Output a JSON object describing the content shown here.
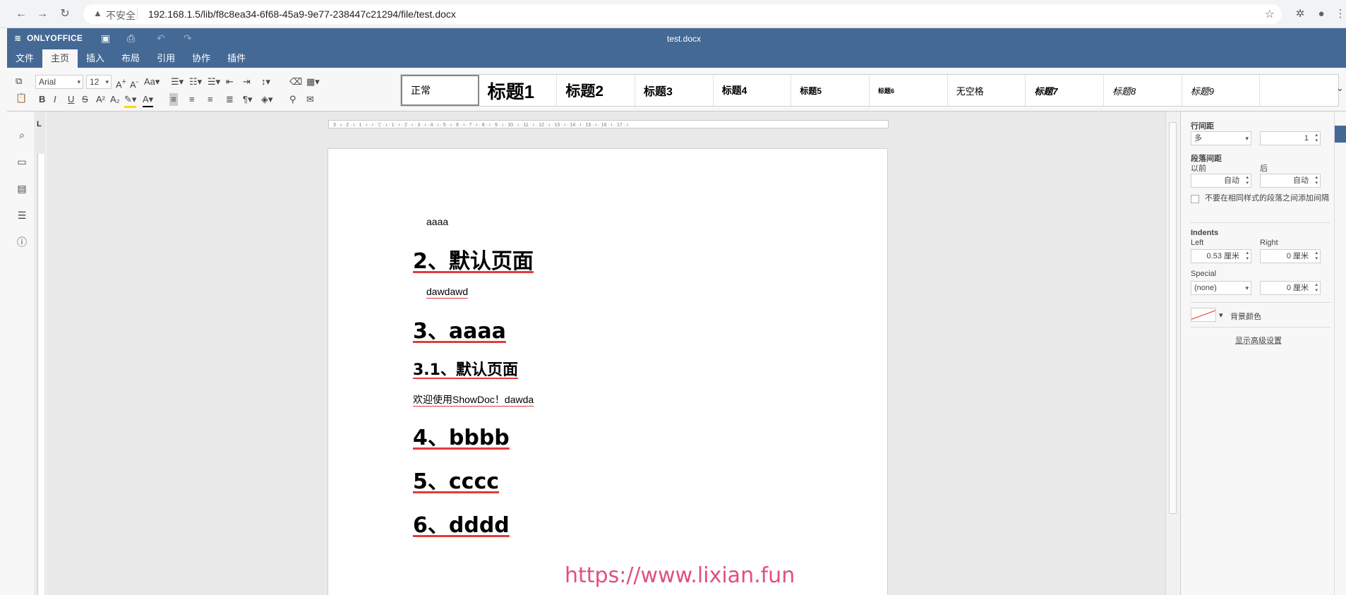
{
  "browser": {
    "insecure_label": "不安全",
    "url": "192.168.1.5/lib/f8c8ea34-6f68-45a9-9e77-238447c21294/file/test.docx"
  },
  "app": {
    "brand": "ONLYOFFICE",
    "doc_title": "test.docx",
    "accent": "#446995",
    "menu_tabs": [
      "文件",
      "主页",
      "插入",
      "布局",
      "引用",
      "协作",
      "插件"
    ],
    "active_tab": "主页"
  },
  "ribbon": {
    "font_name": "Arial",
    "font_size": "12",
    "styles": [
      "正常",
      "标题1",
      "标题2",
      "标题3",
      "标题4",
      "标题5",
      "标题6",
      "无空格",
      "标题7",
      "标题8",
      "标题9"
    ]
  },
  "document": {
    "lines": {
      "p1": "aaaa",
      "h2": "2、默认页面",
      "p2": "dawdawd",
      "h3": "3、aaaa",
      "h31": "3.1、默认页面",
      "p3": "欢迎使用ShowDoc！dawda",
      "h4": "4、bbbb",
      "h5": "5、cccc",
      "h6": "6、dddd"
    },
    "watermark": "https://www.lixian.fun"
  },
  "right_panel": {
    "line_spacing_label": "行间距",
    "line_spacing_mode": "多",
    "line_spacing_value": "1",
    "para_spacing_label": "段落间距",
    "before_label": "以前",
    "after_label": "后",
    "before_value": "自动",
    "after_value": "自动",
    "no_space_checkbox": "不要在相同样式的段落之间添加间隔",
    "indents_label": "Indents",
    "left_label": "Left",
    "right_label": "Right",
    "left_value": "0.53 厘米",
    "right_value": "0 厘米",
    "special_label": "Special",
    "special_value": "(none)",
    "special_amount": "0 厘米",
    "bg_color_label": "背景颜色",
    "advanced_link": "显示高级设置"
  }
}
